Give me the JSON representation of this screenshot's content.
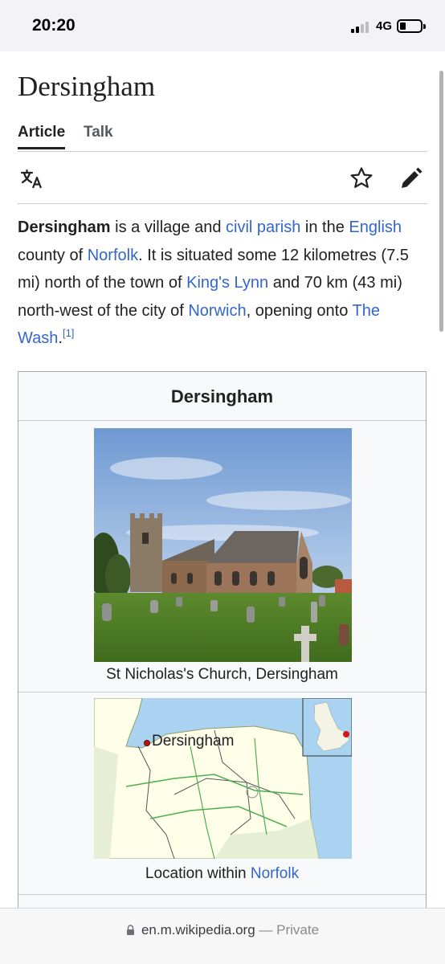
{
  "status_bar": {
    "time": "20:20",
    "network": "4G"
  },
  "article": {
    "title": "Dersingham",
    "tabs": [
      "Article",
      "Talk"
    ],
    "toolbar_icons": [
      "language-icon",
      "star-icon",
      "edit-pencil-icon"
    ],
    "lead": {
      "subject": "Dersingham",
      "t1": " is a village and ",
      "link_civil_parish": "civil parish",
      "t2": " in the ",
      "link_english": "English",
      "t3": " county of ",
      "link_norfolk": "Norfolk",
      "t4": ". It is situated some 12 kilometres (7.5 mi) north of the town of ",
      "link_kings_lynn": "King's Lynn",
      "t5": " and 70 km (43 mi) north-west of the city of ",
      "link_norwich": "Norwich",
      "t6": ", opening onto ",
      "link_the_wash": "The Wash",
      "t7": ".",
      "ref": "[1]"
    }
  },
  "infobox": {
    "title": "Dersingham",
    "image_caption": "St Nicholas's Church, Dersingham",
    "map_label": "Dersingham",
    "location_prefix": "Location within ",
    "location_link": "Norfolk"
  },
  "bottom_bar": {
    "url": "en.m.wikipedia.org",
    "separator": " — ",
    "mode": "Private"
  },
  "colors": {
    "link": "#3366cc",
    "text": "#202122",
    "infobox_bg": "#f8f9fa",
    "border": "#a2a9b1"
  }
}
